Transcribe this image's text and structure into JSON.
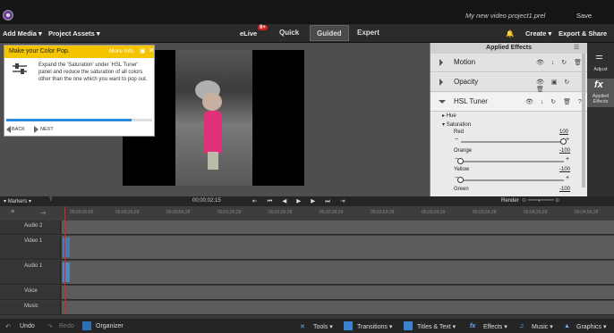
{
  "window": {
    "doc_title": "My new video project1.prel",
    "save_label": "Save"
  },
  "menubar": {
    "add_media": "Add Media",
    "project_assets": "Project Assets",
    "elive": "eLive",
    "elive_badge": "9+",
    "modes": [
      "Quick",
      "Guided",
      "Expert"
    ],
    "active_mode": "Guided",
    "create": "Create",
    "export_share": "Export & Share"
  },
  "hint": {
    "title": "Make your Color Pop.",
    "more_info": "More Info",
    "body": "Expand the 'Saturation' under 'HSL Tuner' panel and reduce the saturation of all colors other than the one which you want to pop out.",
    "back": "BACK",
    "next": "NEXT",
    "progress": 0.86
  },
  "effects_panel": {
    "title": "Applied Effects",
    "effects": [
      "Motion",
      "Opacity",
      "HSL Tuner"
    ],
    "hue_label": "Hue",
    "saturation_label": "Saturation",
    "params": [
      {
        "name": "Red",
        "value": "100",
        "fraction": 1.0
      },
      {
        "name": "Orange",
        "value": "-100",
        "fraction": 0.0
      },
      {
        "name": "Yellow",
        "value": "-100",
        "fraction": 0.0
      },
      {
        "name": "Green",
        "value": "-100",
        "fraction": 0.0
      }
    ]
  },
  "right_bar": {
    "adjust": "Adjust",
    "applied_effects": "Applied Effects"
  },
  "timeline": {
    "markers": "Markers",
    "timecode": "00;00;02;15",
    "render": "Render",
    "ruler_ticks": [
      "00;00;00;00",
      "00;00;29;29",
      "00;00;59;28",
      "00;01;29;29",
      "00;01;59;28",
      "00;02;29;29",
      "00;02;59;28",
      "00;03;29;29",
      "00;03;59;28",
      "00;04;29;29",
      "00;04;59;28"
    ],
    "tracks": [
      "Audio 2",
      "Video 1",
      "Audio 1",
      "Voice",
      "Music"
    ]
  },
  "bottombar": {
    "undo": "Undo",
    "redo": "Redo",
    "organizer": "Organizer",
    "tools": "Tools",
    "transitions": "Transitions",
    "titles_text": "Titles & Text",
    "effects": "Effects",
    "music": "Music",
    "graphics": "Graphics"
  }
}
